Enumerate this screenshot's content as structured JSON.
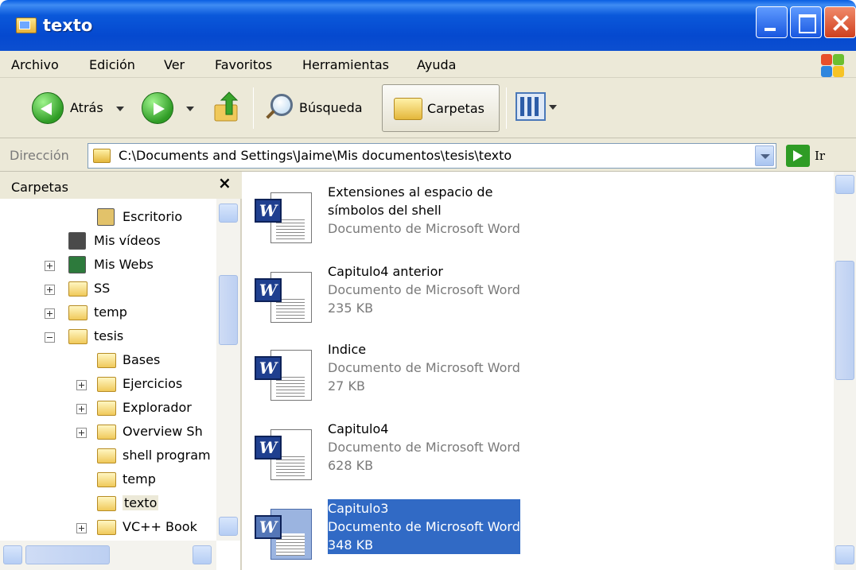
{
  "window": {
    "title": "texto"
  },
  "menu": [
    "Archivo",
    "Edición",
    "Ver",
    "Favoritos",
    "Herramientas",
    "Ayuda"
  ],
  "toolbar": {
    "back_label": "Atrás",
    "search_label": "Búsqueda",
    "folders_label": "Carpetas"
  },
  "address": {
    "label": "Dirección",
    "path": "C:\\Documents and Settings\\Jaime\\Mis documentos\\tesis\\texto",
    "go_label": "Ir"
  },
  "folders_pane": {
    "title": "Carpetas",
    "close": "×",
    "items": [
      {
        "label": "Escritorio",
        "kind": "desktop",
        "expander": "none"
      },
      {
        "label": "Mis vídeos",
        "kind": "videos",
        "expander": "none"
      },
      {
        "label": "Mis Webs",
        "kind": "webs",
        "expander": "plus"
      },
      {
        "label": "SS",
        "kind": "folder",
        "expander": "plus"
      },
      {
        "label": "temp",
        "kind": "folder",
        "expander": "plus"
      },
      {
        "label": "tesis",
        "kind": "folder",
        "expander": "minus"
      },
      {
        "label": "Bases",
        "kind": "folder",
        "expander": "none"
      },
      {
        "label": "Ejercicios",
        "kind": "folder",
        "expander": "plus"
      },
      {
        "label": "Explorador",
        "kind": "folder",
        "expander": "plus"
      },
      {
        "label": "Overview Sh",
        "kind": "folder",
        "expander": "plus"
      },
      {
        "label": "shell program",
        "kind": "folder",
        "expander": "none"
      },
      {
        "label": "temp",
        "kind": "folder",
        "expander": "none"
      },
      {
        "label": "texto",
        "kind": "folder",
        "expander": "none",
        "selected": true
      },
      {
        "label": "VC++ Book",
        "kind": "folder",
        "expander": "plus"
      }
    ]
  },
  "files": [
    {
      "name": "Extensiones al espacio de",
      "name2": "símbolos del shell",
      "type": "Documento de Microsoft Word",
      "size": ""
    },
    {
      "name": "Capitulo4 anterior",
      "type": "Documento de Microsoft Word",
      "size": "235 KB"
    },
    {
      "name": "Indice",
      "type": "Documento de Microsoft Word",
      "size": "27 KB"
    },
    {
      "name": "Capitulo4",
      "type": "Documento de Microsoft Word",
      "size": "628 KB"
    },
    {
      "name": "Capitulo3",
      "type": "Documento de Microsoft Word",
      "size": "348 KB",
      "selected": true
    }
  ],
  "colors": {
    "titlebar": "#0a58da",
    "selection": "#316ac5",
    "chrome": "#ece9d8"
  }
}
